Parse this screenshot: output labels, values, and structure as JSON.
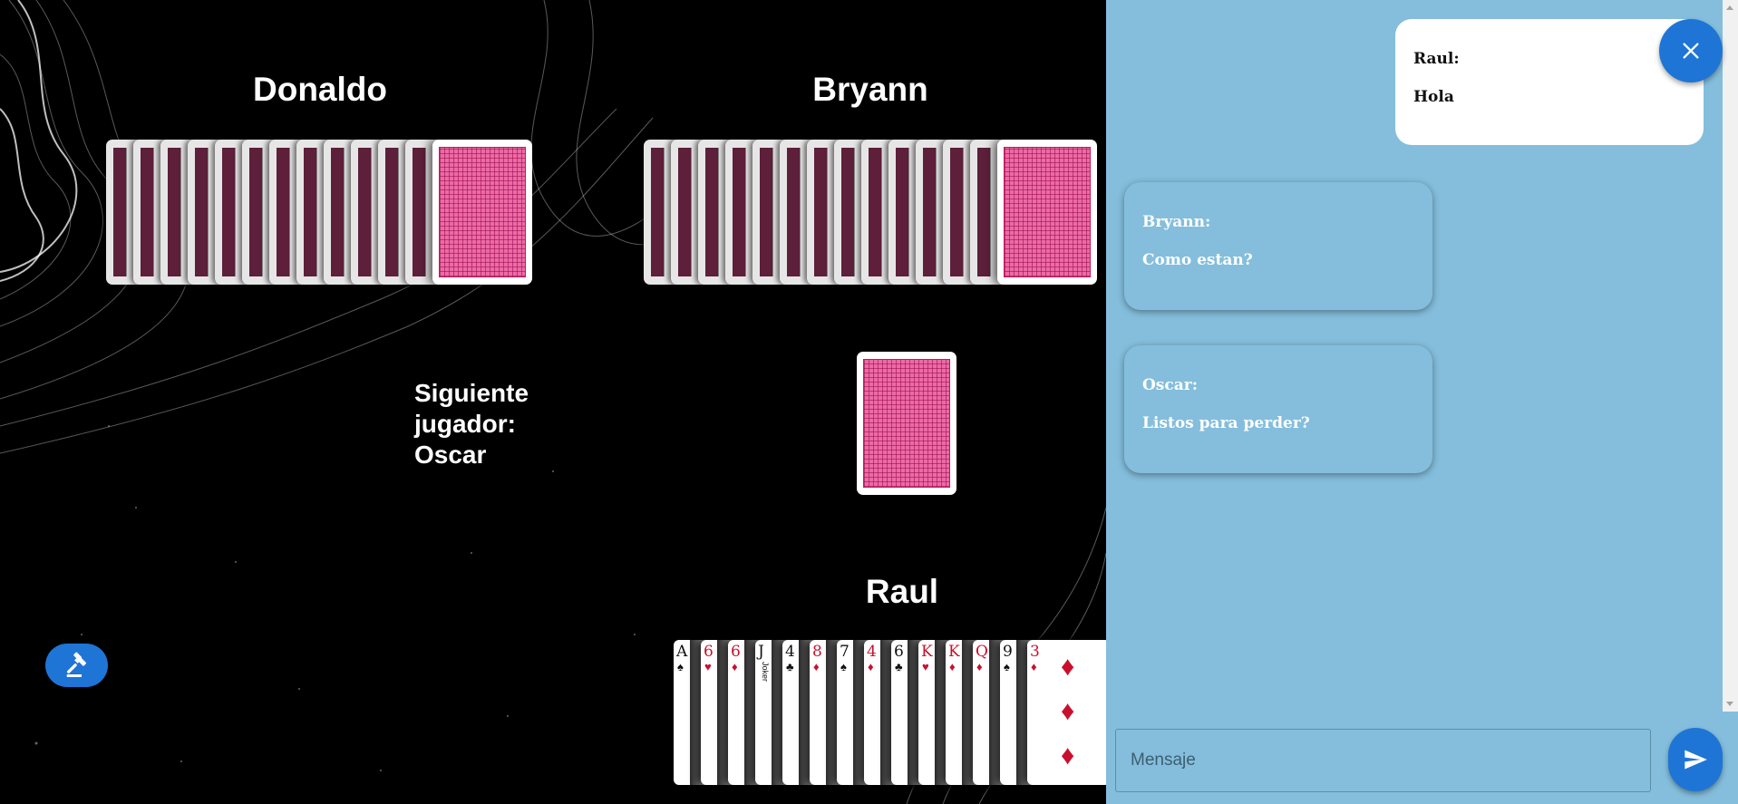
{
  "players": {
    "left": {
      "name": "Donaldo",
      "card_count": 13
    },
    "right": {
      "name": "Bryann",
      "card_count": 15
    },
    "me": {
      "name": "Raul"
    }
  },
  "status": {
    "next_player": "Siguiente jugador: Oscar"
  },
  "my_hand": [
    {
      "rank": "A",
      "suit": "♠",
      "color": "black"
    },
    {
      "rank": "6",
      "suit": "♥",
      "color": "red"
    },
    {
      "rank": "6",
      "suit": "♦",
      "color": "red"
    },
    {
      "rank": "J",
      "suit": "",
      "color": "black",
      "label": "Joker"
    },
    {
      "rank": "4",
      "suit": "♣",
      "color": "black"
    },
    {
      "rank": "8",
      "suit": "♦",
      "color": "red"
    },
    {
      "rank": "7",
      "suit": "♠",
      "color": "black"
    },
    {
      "rank": "4",
      "suit": "♦",
      "color": "red"
    },
    {
      "rank": "6",
      "suit": "♣",
      "color": "black"
    },
    {
      "rank": "K",
      "suit": "♥",
      "color": "red"
    },
    {
      "rank": "K",
      "suit": "♦",
      "color": "red"
    },
    {
      "rank": "Q",
      "suit": "♦",
      "color": "red"
    },
    {
      "rank": "9",
      "suit": "♠",
      "color": "black"
    },
    {
      "rank": "3",
      "suit": "♦",
      "color": "red"
    }
  ],
  "chat": {
    "messages": [
      {
        "sender": "Raul:",
        "text": "Hola"
      },
      {
        "sender": "Bryann:",
        "text": "Como estan?"
      },
      {
        "sender": "Oscar:",
        "text": "Listos para perder?"
      }
    ],
    "input_placeholder": "Mensaje"
  },
  "icons": {
    "close": "close-icon",
    "send": "send-icon",
    "hammer": "gavel-icon"
  },
  "colors": {
    "accent": "#1e75d6",
    "chat_bg": "#84bedc",
    "card_back": "#ec6aa6"
  }
}
